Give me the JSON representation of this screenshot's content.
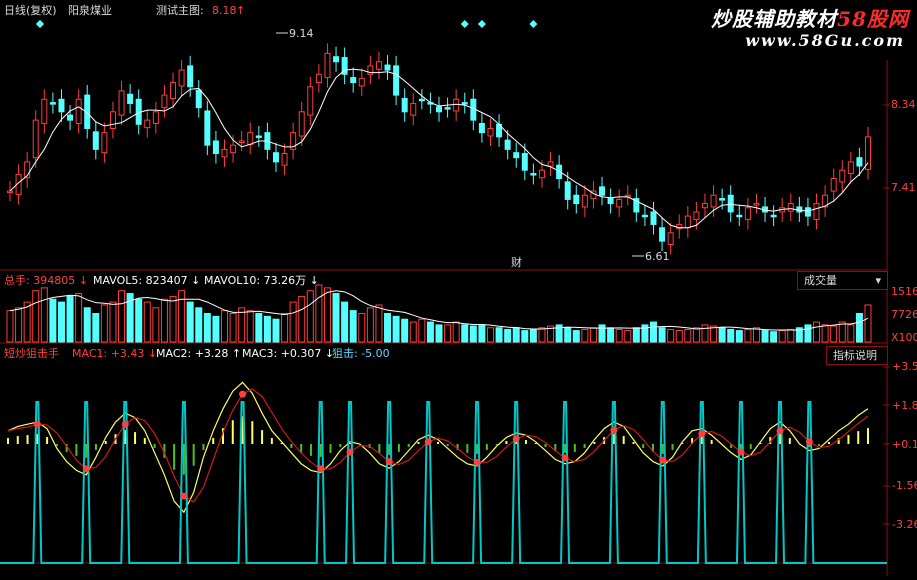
{
  "header": {
    "period": "日线(复权)",
    "stock_name": "阳泉煤业",
    "indicator": "测试主图:",
    "indicator_value": "8.18",
    "indicator_arrow": "↑"
  },
  "watermark": {
    "line1_a": "炒股辅助教材",
    "line1_b": "58股网",
    "line2": "www.58Gu.com"
  },
  "price_panel": {
    "high_label": "9.14",
    "low_label": "6.61",
    "y_ticks": [
      "8.34",
      "7.41"
    ],
    "event_marker": "财"
  },
  "volume_panel": {
    "items": [
      {
        "label": "总手:",
        "value": "394805",
        "arrow": "↓",
        "color": "#ff4040"
      },
      {
        "label": "MAVOL5:",
        "value": "823407",
        "arrow": "↓",
        "color": "#ffffff"
      },
      {
        "label": "MAVOL10:",
        "value": "73.26万",
        "arrow": "↓",
        "color": "#ffffff"
      }
    ],
    "button": "成交量",
    "y_ticks": [
      "1516",
      "7726",
      "X100"
    ]
  },
  "macd_panel": {
    "items": [
      {
        "label": "短炒狙击手",
        "value": "",
        "arrow": "",
        "color": "#ff4040"
      },
      {
        "label": "MAC1:",
        "value": "+3.43",
        "arrow": "↓",
        "color": "#ff4040"
      },
      {
        "label": "MAC2:",
        "value": "+3.28",
        "arrow": "↑",
        "color": "#ffffff"
      },
      {
        "label": "MAC3:",
        "value": "+0.307",
        "arrow": "↓",
        "color": "#ffffff"
      },
      {
        "label": "狙击:",
        "value": "-5.00",
        "arrow": "",
        "color": "#5fd7ff"
      }
    ],
    "button": "指标说明",
    "y_ticks": [
      "+3.54",
      "+1.83",
      "+0.12",
      "-1.56",
      "-3.26"
    ]
  },
  "colors": {
    "up": "#ff3c3c",
    "down": "#54ffff",
    "frame": "#8a1010",
    "ma": "#ffffff",
    "sniper": "#00c8c8",
    "mac1": "#d01818",
    "mac2": "#ffff60",
    "pos_bar": "#ffff60",
    "neg_bar": "#50c020",
    "diamond": "#54ffff"
  },
  "chart_data": [
    {
      "type": "candlestick",
      "ticks": [
        "8.34",
        "7.41"
      ],
      "close": [
        7.35,
        7.55,
        7.7,
        8.2,
        8.45,
        8.4,
        8.3,
        8.2,
        8.45,
        8.1,
        7.85,
        8.05,
        8.3,
        8.55,
        8.4,
        8.15,
        8.2,
        8.3,
        8.5,
        8.65,
        8.8,
        8.6,
        8.35,
        7.9,
        7.8,
        7.85,
        7.9,
        7.95,
        8.05,
        8.0,
        7.85,
        7.7,
        7.8,
        8.05,
        8.3,
        8.6,
        8.75,
        9.0,
        8.9,
        8.75,
        8.65,
        8.7,
        8.85,
        8.9,
        8.8,
        8.5,
        8.3,
        8.4,
        8.45,
        8.4,
        8.3,
        8.35,
        8.45,
        8.4,
        8.2,
        8.05,
        8.1,
        8.0,
        7.85,
        7.75,
        7.6,
        7.55,
        7.6,
        7.7,
        7.5,
        7.25,
        7.2,
        7.3,
        7.35,
        7.3,
        7.2,
        7.25,
        7.3,
        7.1,
        7.05,
        6.95,
        6.75,
        6.85,
        6.95,
        7.05,
        7.1,
        7.2,
        7.3,
        7.25,
        7.1,
        7.05,
        7.15,
        7.2,
        7.1,
        7.05,
        7.15,
        7.2,
        7.1,
        7.05,
        7.2,
        7.3,
        7.5,
        7.6,
        7.7,
        7.65,
        8.0
      ],
      "high_label": 9.14,
      "low_label": 6.61
    },
    {
      "type": "bar",
      "name": "volume",
      "values": [
        0.55,
        0.6,
        0.7,
        0.9,
        0.95,
        0.75,
        0.7,
        0.8,
        0.85,
        0.6,
        0.5,
        0.65,
        0.7,
        0.9,
        0.85,
        0.75,
        0.7,
        0.6,
        0.75,
        0.8,
        0.9,
        0.7,
        0.6,
        0.5,
        0.45,
        0.55,
        0.5,
        0.6,
        0.55,
        0.5,
        0.45,
        0.4,
        0.5,
        0.7,
        0.8,
        0.9,
        1.0,
        0.95,
        0.85,
        0.7,
        0.55,
        0.5,
        0.6,
        0.65,
        0.5,
        0.45,
        0.4,
        0.35,
        0.4,
        0.35,
        0.3,
        0.3,
        0.35,
        0.3,
        0.28,
        0.3,
        0.25,
        0.25,
        0.22,
        0.25,
        0.2,
        0.22,
        0.25,
        0.28,
        0.3,
        0.25,
        0.2,
        0.22,
        0.25,
        0.3,
        0.25,
        0.22,
        0.2,
        0.25,
        0.3,
        0.35,
        0.25,
        0.22,
        0.2,
        0.22,
        0.25,
        0.3,
        0.28,
        0.25,
        0.22,
        0.2,
        0.22,
        0.25,
        0.2,
        0.18,
        0.2,
        0.22,
        0.25,
        0.3,
        0.35,
        0.3,
        0.28,
        0.35,
        0.3,
        0.5,
        0.65
      ]
    },
    {
      "type": "line",
      "name": "MAC1/MAC2/MAC3",
      "ticks": [
        "+3.54",
        "+1.83",
        "+0.12",
        "-1.56",
        "-3.26"
      ],
      "mac3": [
        0.6,
        0.8,
        0.9,
        1.0,
        0.7,
        -0.2,
        -0.8,
        -1.2,
        -1.4,
        -0.6,
        0.3,
        1.0,
        1.4,
        1.2,
        0.6,
        -0.4,
        -1.4,
        -2.6,
        -3.1,
        -2.2,
        -0.6,
        0.6,
        1.6,
        2.4,
        2.8,
        2.3,
        1.4,
        0.6,
        0.1,
        -0.4,
        -0.9,
        -1.2,
        -1.3,
        -0.9,
        -0.3,
        0.1,
        0.0,
        -0.4,
        -0.9,
        -1.1,
        -0.8,
        -0.3,
        0.2,
        0.4,
        0.2,
        -0.2,
        -0.6,
        -0.9,
        -1.0,
        -0.6,
        -0.1,
        0.3,
        0.5,
        0.4,
        0.1,
        -0.3,
        -0.7,
        -0.9,
        -0.8,
        -0.4,
        0.2,
        0.7,
        1.0,
        0.8,
        0.2,
        -0.4,
        -0.8,
        -1.0,
        -0.6,
        0.1,
        0.6,
        0.7,
        0.4,
        0.0,
        -0.4,
        -0.7,
        -0.5,
        0.1,
        0.7,
        1.0,
        0.6,
        0.0,
        -0.3,
        -0.2,
        0.2,
        0.6,
        0.9,
        1.3,
        1.6
      ]
    }
  ]
}
